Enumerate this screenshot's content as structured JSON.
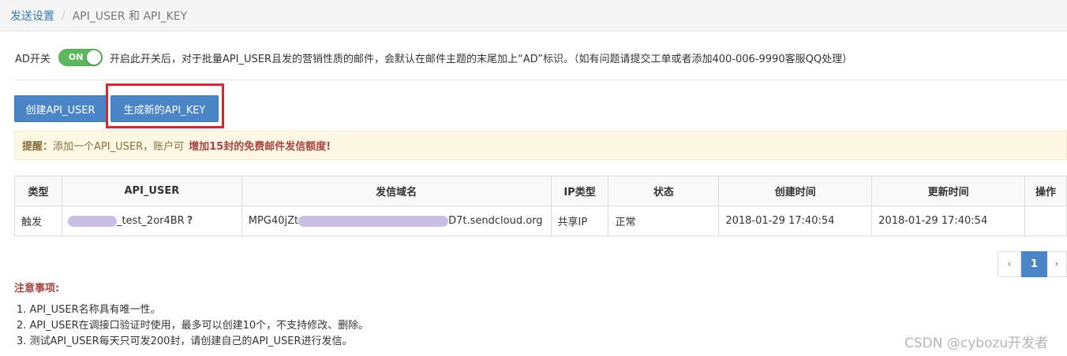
{
  "breadcrumb": {
    "parent": "发送设置",
    "separator": "/",
    "current": "API_USER 和 API_KEY"
  },
  "ad_switch": {
    "label": "AD开关",
    "toggle_text": "ON",
    "state": "on",
    "description": "开启此开关后，对于批量API_USER且发的营销性质的邮件，会默认在邮件主题的末尾加上“AD”标识。（如有问题请提交工单或者添加400-006-9990客服QQ处理）"
  },
  "buttons": {
    "create": "创建API_USER",
    "generate": "生成新的API_KEY"
  },
  "alert": {
    "prefix": "提醒：",
    "text": "添加一个API_USER，账户可",
    "strong": "增加15封的免费邮件发信额度!"
  },
  "table": {
    "headers": {
      "type": "类型",
      "user": "API_USER",
      "domain": "发信域名",
      "ip": "IP类型",
      "status": "状态",
      "created": "创建时间",
      "updated": "更新时间",
      "ops": "操作"
    },
    "rows": [
      {
        "type": "触发",
        "user_suffix": "_test_2or4BR",
        "help": "?",
        "domain_prefix": "MPG40jZt",
        "domain_suffix": "D7t.sendcloud.org",
        "ip": "共享IP",
        "status": "正常",
        "created": "2018-01-29 17:40:54",
        "updated": "2018-01-29 17:40:54",
        "ops": ""
      }
    ]
  },
  "pagination": {
    "prev": "‹",
    "current": "1",
    "next": "›"
  },
  "notes": {
    "title": "注意事项:",
    "items": [
      "1. API_USER名称具有唯一性。",
      "2. API_USER在调接口验证时使用，最多可以创建10个，不支持修改、删除。",
      "3. 测试API_USER每天只可发200封，请创建自己的API_USER进行发信。"
    ]
  },
  "watermark": "CSDN @cybozu开发者",
  "colors": {
    "primary": "#4a86c7",
    "toggle_on": "#5cb85c",
    "highlight": "#e0242f",
    "alert_bg": "#fcf8e3",
    "danger_text": "#a94442"
  }
}
